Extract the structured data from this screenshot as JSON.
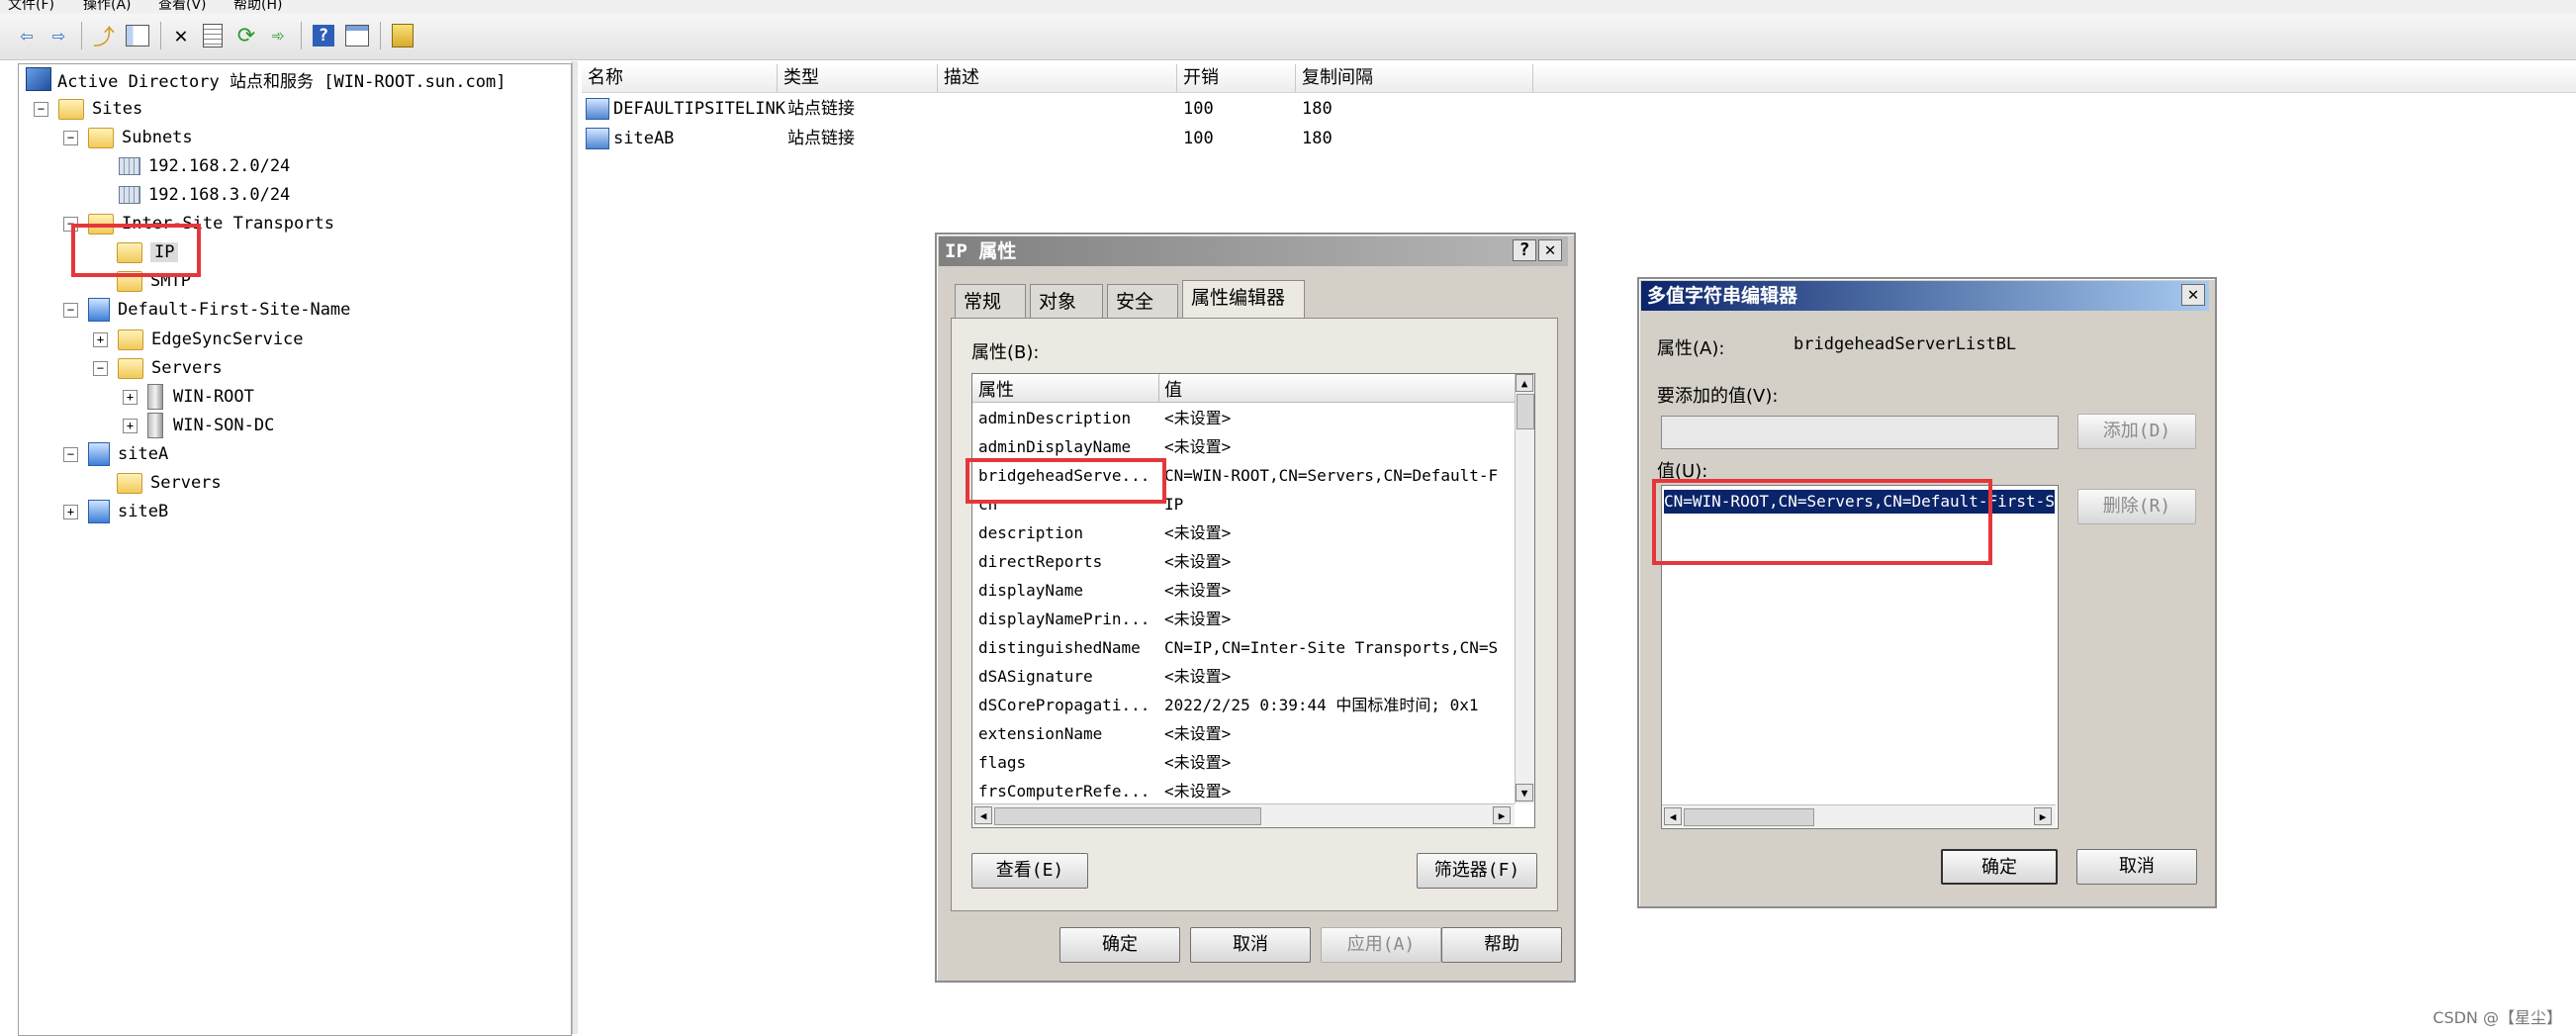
{
  "menubar": {
    "items": [
      "文件(F)",
      "操作(A)",
      "查看(V)",
      "帮助(H)"
    ]
  },
  "toolbar": {
    "buttons": [
      "back-icon",
      "forward-icon",
      "up-folder-icon",
      "show-tree-icon",
      "delete-icon",
      "properties-icon",
      "refresh-icon",
      "export-icon",
      "help-icon",
      "view-icon",
      "console-icon"
    ]
  },
  "tree": {
    "root": "Active Directory 站点和服务 [WIN-ROOT.sun.com]",
    "sites": "Sites",
    "subnets": "Subnets",
    "subnet1": "192.168.2.0/24",
    "subnet2": "192.168.3.0/24",
    "inter_site": "Inter-Site Transports",
    "ip": "IP",
    "smtp": "SMTP",
    "default_site": "Default-First-Site-Name",
    "edgesync": "EdgeSyncService",
    "servers": "Servers",
    "win_root": "WIN-ROOT",
    "win_son": "WIN-SON-DC",
    "siteA": "siteA",
    "siteA_servers": "Servers",
    "siteB": "siteB",
    "expand_minus": "−",
    "expand_plus": "+"
  },
  "list": {
    "columns": [
      "名称",
      "类型",
      "描述",
      "开销",
      "复制间隔"
    ],
    "rows": [
      {
        "name": "DEFAULTIPSITELINK",
        "type": "站点链接",
        "desc": "",
        "cost": "100",
        "interval": "180"
      },
      {
        "name": "siteAB",
        "type": "站点链接",
        "desc": "",
        "cost": "100",
        "interval": "180"
      }
    ]
  },
  "ip_dialog": {
    "title": "IP 属性",
    "help_btn": "?",
    "close_btn": "✕",
    "tabs": [
      "常规",
      "对象",
      "安全",
      "属性编辑器"
    ],
    "attributes_label": "属性(B):",
    "col_attr": "属性",
    "col_value": "值",
    "rows": [
      {
        "attr": "adminDescription",
        "value": "<未设置>"
      },
      {
        "attr": "adminDisplayName",
        "value": "<未设置>"
      },
      {
        "attr": "bridgeheadServe...",
        "value": "CN=WIN-ROOT,CN=Servers,CN=Default-F"
      },
      {
        "attr": "cn",
        "value": "IP"
      },
      {
        "attr": "description",
        "value": "<未设置>"
      },
      {
        "attr": "directReports",
        "value": "<未设置>"
      },
      {
        "attr": "displayName",
        "value": "<未设置>"
      },
      {
        "attr": "displayNamePrin...",
        "value": "<未设置>"
      },
      {
        "attr": "distinguishedName",
        "value": "CN=IP,CN=Inter-Site Transports,CN=S"
      },
      {
        "attr": "dSASignature",
        "value": "<未设置>"
      },
      {
        "attr": "dSCorePropagati...",
        "value": "2022/2/25 0:39:44 中国标准时间; 0x1"
      },
      {
        "attr": "extensionName",
        "value": "<未设置>"
      },
      {
        "attr": "flags",
        "value": "<未设置>"
      },
      {
        "attr": "frsComputerRefe...",
        "value": "<未设置>"
      }
    ],
    "view_btn": "查看(E)",
    "filter_btn": "筛选器(F)",
    "ok_btn": "确定",
    "cancel_btn": "取消",
    "apply_btn": "应用(A)",
    "help_text_btn": "帮助"
  },
  "mv_dialog": {
    "title": "多值字符串编辑器",
    "close_btn": "✕",
    "attr_label": "属性(A):",
    "attr_value": "bridgeheadServerListBL",
    "add_label": "要添加的值(V):",
    "add_input": "",
    "add_btn": "添加(D)",
    "values_label": "值(U):",
    "values": [
      "CN=WIN-ROOT,CN=Servers,CN=Default-First-S"
    ],
    "remove_btn": "删除(R)",
    "ok_btn": "确定",
    "cancel_btn": "取消"
  },
  "watermark": "CSDN @【星尘】",
  "colors": {
    "highlight": "#e5373b",
    "selection": "#0a246a",
    "title_active": "#0a246a",
    "title_inactive": "#808080"
  }
}
